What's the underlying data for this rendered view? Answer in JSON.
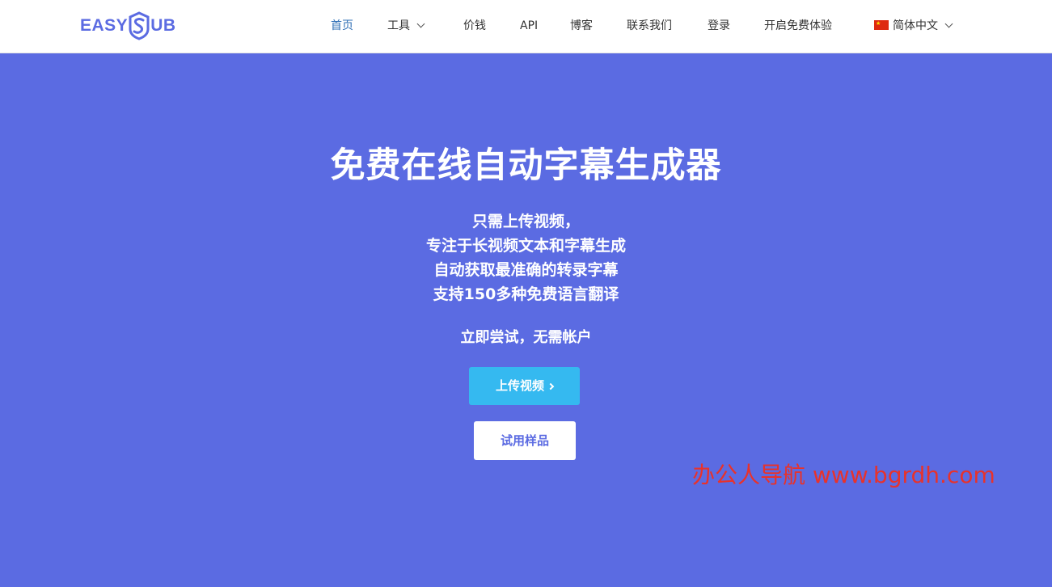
{
  "brand": {
    "logo_left": "EASY",
    "logo_right": "UB",
    "color": "#5b6be2"
  },
  "nav": {
    "home": "首页",
    "tools": "工具",
    "pricing": "价钱",
    "api": "API",
    "blog": "博客",
    "contact": "联系我们",
    "login": "登录",
    "free_trial": "开启免费体验",
    "language": "简体中文",
    "active_color": "#2f6fb5"
  },
  "hero": {
    "title": "免费在线自动字幕生成器",
    "lines": [
      "只需上传视频，",
      "专注于长视频文本和字幕生成",
      "自动获取最准确的转录字幕",
      "支持150多种免费语言翻译"
    ],
    "try_text": "立即尝试，无需帐户",
    "upload_button": "上传视频",
    "sample_button": "试用样品",
    "background": "#5b6be2",
    "upload_color": "#35b9f0"
  },
  "watermark": "办公人导航 www.bgrdh.com"
}
